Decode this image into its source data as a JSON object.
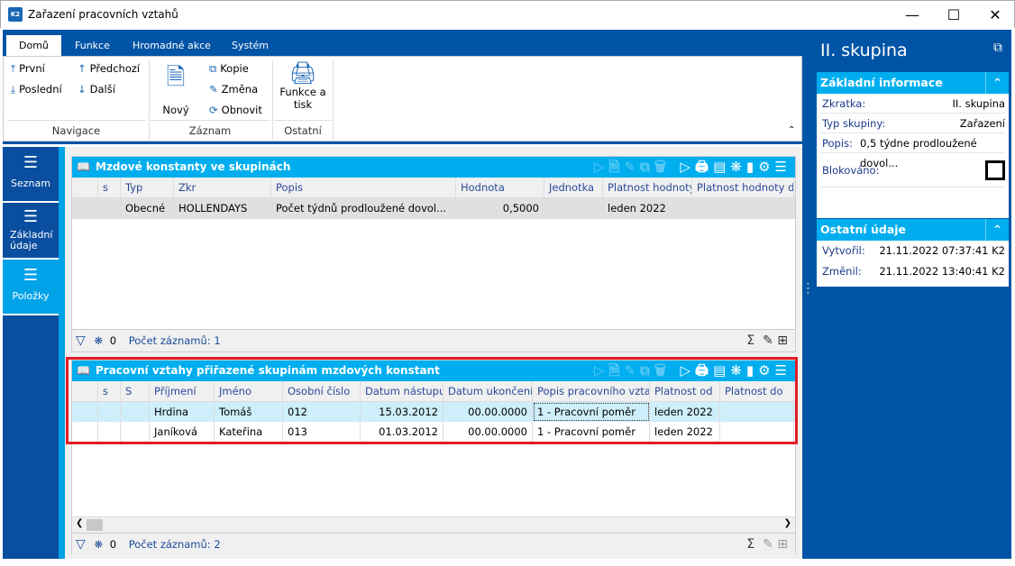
{
  "window": {
    "title": "Zařazení pracovních vztahů",
    "logo": "K2",
    "controls": [
      "minimize",
      "maximize",
      "close"
    ]
  },
  "ribbon": {
    "tabs": [
      "Domů",
      "Funkce",
      "Hromadné akce",
      "Systém"
    ],
    "navigace": {
      "label": "Navigace",
      "items": [
        "První",
        "Poslední",
        "Předchozí",
        "Další"
      ]
    },
    "zaznam": {
      "label": "Záznam",
      "new": "Nový",
      "items": [
        "Kopie",
        "Změna",
        "Obnovit"
      ]
    },
    "ostatni": {
      "label": "Ostatní",
      "print": "Funkce a tisk"
    }
  },
  "leftnav": {
    "items": [
      {
        "label": "Seznam"
      },
      {
        "label": "Základní údaje"
      },
      {
        "label": "Položky",
        "active": true
      }
    ]
  },
  "grid1": {
    "title": "Mzdové konstanty ve skupinách",
    "columns": [
      "",
      "s",
      "Typ",
      "Zkr",
      "Popis",
      "Hodnota",
      "Jednotka",
      "Platnost hodnoty",
      "Platnost hodnoty do"
    ],
    "rows": [
      [
        "",
        "",
        "Obecné",
        "HOLLENDAYS",
        "Počet týdnů prodloužené dovol...",
        "0,5000",
        "",
        "leden 2022",
        ""
      ]
    ],
    "footer": {
      "marked": "0",
      "count": "Počet záznamů: 1"
    }
  },
  "grid2": {
    "title": "Pracovní vztahy přiřazené skupinám mzdových konstant",
    "columns": [
      "",
      "s",
      "S",
      "Příjmení",
      "Jméno",
      "Osobní číslo",
      "Datum nástupu",
      "Datum ukončení",
      "Popis pracovního vztahu",
      "Platnost od",
      "Platnost do"
    ],
    "rows": [
      [
        "",
        "",
        "",
        "Hrdina",
        "Tomáš",
        "012",
        "15.03.2012",
        "00.00.0000",
        "1 - Pracovní poměr",
        "leden 2022",
        ""
      ],
      [
        "",
        "",
        "",
        "Janíková",
        "Kateřina",
        "013",
        "01.03.2012",
        "00.00.0000",
        "1 - Pracovní poměr",
        "leden 2022",
        ""
      ]
    ],
    "footer": {
      "marked": "0",
      "count": "Počet záznamů: 2"
    }
  },
  "right": {
    "title": "II. skupina",
    "basic": {
      "header": "Základní informace",
      "fields": [
        {
          "k": "Zkratka:",
          "v": "II. skupina"
        },
        {
          "k": "Typ skupiny:",
          "v": "Zařazení"
        },
        {
          "k": "Popis:",
          "v": "0,5 týdne prodloužené dovol..."
        },
        {
          "k": "Blokováno:",
          "v": ""
        }
      ],
      "blocked": false
    },
    "other": {
      "header": "Ostatní údaje",
      "fields": [
        {
          "k": "Vytvořil:",
          "v": "21.11.2022 07:37:41 K2"
        },
        {
          "k": "Změnil:",
          "v": "21.11.2022 13:40:41 K2"
        }
      ]
    }
  },
  "colors": {
    "ribbon": "#0054a6",
    "accent": "#00aeef",
    "highlight": "#e01e28",
    "selected_row": "#cdeefa"
  }
}
